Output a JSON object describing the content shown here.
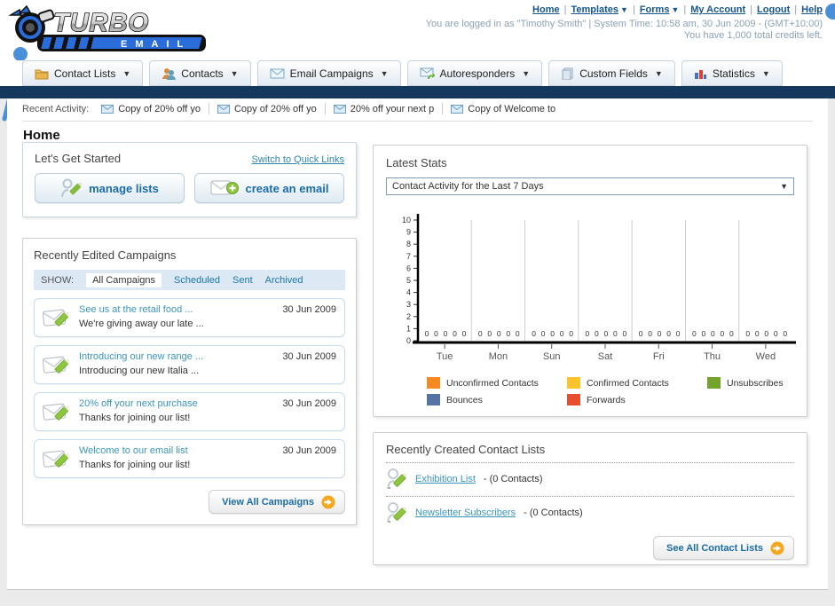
{
  "header": {
    "logo_title": "TURBO",
    "logo_subtitle": "EMAIL",
    "nav": [
      {
        "label": "Home",
        "dropdown": false
      },
      {
        "label": "Templates",
        "dropdown": true
      },
      {
        "label": "Forms",
        "dropdown": true
      },
      {
        "label": "My Account",
        "dropdown": false
      },
      {
        "label": "Logout",
        "dropdown": false
      },
      {
        "label": "Help",
        "dropdown": false
      }
    ],
    "login_line": "You are logged in as \"Timothy Smith\" | System Time: 10:58 am, 30 Jun 2009 - (GMT+10:00)",
    "credits_line": "You have 1,000 total credits left."
  },
  "tabs": [
    {
      "label": "Contact Lists"
    },
    {
      "label": "Contacts"
    },
    {
      "label": "Email Campaigns"
    },
    {
      "label": "Autoresponders"
    },
    {
      "label": "Custom Fields"
    },
    {
      "label": "Statistics"
    }
  ],
  "recent_activity": {
    "label": "Recent Activity:",
    "items": [
      "Copy of 20% off yo",
      "Copy of 20% off yo",
      "20% off your next p",
      "Copy of Welcome to"
    ]
  },
  "page_title": "Home",
  "get_started": {
    "title": "Let's Get Started",
    "switch_link": "Switch to Quick Links",
    "manage_lists_label": "manage lists",
    "create_email_label": "create an email"
  },
  "campaigns": {
    "title": "Recently Edited Campaigns",
    "show_label": "SHOW:",
    "filters": [
      "All Campaigns",
      "Scheduled",
      "Sent",
      "Archived"
    ],
    "active_filter": "All Campaigns",
    "items": [
      {
        "title": "See us at the retail food ...",
        "subtitle": "We're giving away our late ...",
        "date": "30 Jun 2009"
      },
      {
        "title": "Introducing our new range ...",
        "subtitle": "Introducing our new Italia ...",
        "date": "30 Jun 2009"
      },
      {
        "title": "20% off your next purchase",
        "subtitle": "Thanks for joining our list!",
        "date": "30 Jun 2009"
      },
      {
        "title": "Welcome to our email list",
        "subtitle": "Thanks for joining our list!",
        "date": "30 Jun 2009"
      }
    ],
    "view_all_label": "View All Campaigns"
  },
  "stats": {
    "title": "Latest Stats",
    "period_selected": "Contact Activity for the Last 7 Days"
  },
  "chart_data": {
    "type": "bar",
    "title": "Contact Activity for the Last 7 Days",
    "categories": [
      "Tue",
      "Mon",
      "Sun",
      "Sat",
      "Fri",
      "Thu",
      "Wed"
    ],
    "series": [
      {
        "name": "Unconfirmed Contacts",
        "color": "#F6891F",
        "values": [
          0,
          0,
          0,
          0,
          0,
          0,
          0
        ]
      },
      {
        "name": "Confirmed Contacts",
        "color": "#FCC32B",
        "values": [
          0,
          0,
          0,
          0,
          0,
          0,
          0
        ]
      },
      {
        "name": "Unsubscribes",
        "color": "#73A32D",
        "values": [
          0,
          0,
          0,
          0,
          0,
          0,
          0
        ]
      },
      {
        "name": "Bounces",
        "color": "#5673A6",
        "values": [
          0,
          0,
          0,
          0,
          0,
          0,
          0
        ]
      },
      {
        "name": "Forwards",
        "color": "#E84E2E",
        "values": [
          0,
          0,
          0,
          0,
          0,
          0,
          0
        ]
      }
    ],
    "xlabel": "",
    "ylabel": "",
    "ylim": [
      0,
      10
    ],
    "ytick_step": 1,
    "grid": "vertical",
    "legend_position": "bottom"
  },
  "contact_lists": {
    "title": "Recently Created Contact Lists",
    "items": [
      {
        "name": "Exhibition List",
        "count": "- (0 Contacts)"
      },
      {
        "name": "Newsletter Subscribers",
        "count": "- (0 Contacts)"
      }
    ],
    "see_all_label": "See All Contact Lists"
  }
}
